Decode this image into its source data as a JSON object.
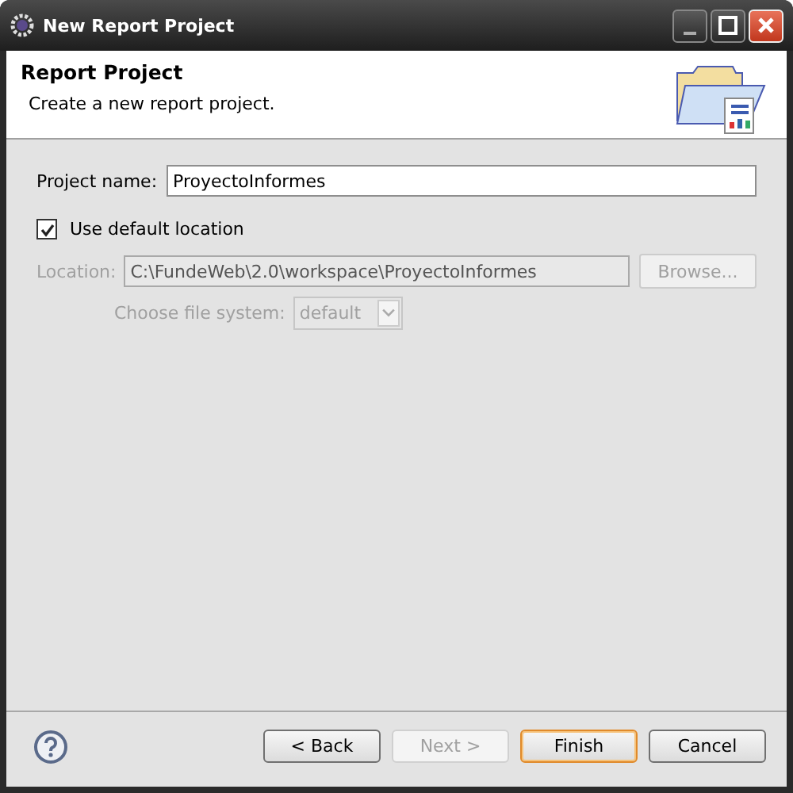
{
  "window": {
    "title": "New Report Project"
  },
  "header": {
    "title": "Report Project",
    "description": "Create a new report project."
  },
  "project_name": {
    "label": "Project name:",
    "value": "ProyectoInformes"
  },
  "use_default_location": {
    "label": "Use default location",
    "checked": true
  },
  "location": {
    "label": "Location:",
    "value": "C:\\FundeWeb\\2.0\\workspace\\ProyectoInformes",
    "disabled": true
  },
  "browse_button": {
    "label": "Browse...",
    "disabled": true
  },
  "file_system": {
    "label": "Choose file system:",
    "value": "default",
    "disabled": true
  },
  "buttons": [
    {
      "label": "< Back",
      "disabled": false,
      "default": false
    },
    {
      "label": "Next >",
      "disabled": true,
      "default": false
    },
    {
      "label": "Finish",
      "disabled": false,
      "default": true
    },
    {
      "label": "Cancel",
      "disabled": false,
      "default": false
    }
  ]
}
